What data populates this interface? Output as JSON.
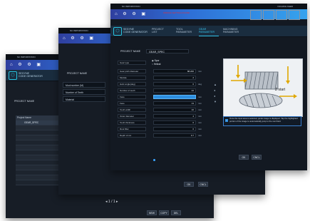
{
  "app": {
    "name": "NC IMPORTATION",
    "brand_line1": "SEGYNE",
    "brand_line2": "CODE GENERATOR"
  },
  "tabs": {
    "project_list": "PROJECT LIST",
    "tool_parameter": "TOOL PARAMETER",
    "gear_parameter": "GEAR PARAMETER",
    "machining_parameter": "MACHINING PARAMETER"
  },
  "window1": {
    "section": "PROJECT NAME",
    "table_header": "Project Name",
    "first_row": "GEAR_SPEC",
    "pager": "1 / 1",
    "buttons": [
      "NEW",
      "COPY",
      "DEL"
    ]
  },
  "window2": {
    "section": "PROJECT NAME",
    "items": [
      "Mod number (M)",
      "Number of Teeth",
      "Material"
    ]
  },
  "window3": {
    "header_warning": "WRONG SETTING FOUND",
    "status": "INCHING FEED",
    "section": "PROJECT NAME",
    "project_value": "GEAR_SPEC",
    "gear_type": "Gear type",
    "radio_options": [
      "Spur",
      "Helical"
    ],
    "params": [
      {
        "label": "Gear pitch diameter",
        "value": "88.200",
        "unit": "mm"
      },
      {
        "label": "Module",
        "value": "2",
        "unit": ""
      },
      {
        "label": "Helix angle(deg)",
        "value": "0",
        "unit": "deg"
      },
      {
        "label": "Number of teeth",
        "value": "42",
        "unit": ""
      },
      {
        "label": "Face",
        "value": "",
        "unit": "mm"
      },
      {
        "label": "Face",
        "value": "13",
        "unit": "mm"
      },
      {
        "label": "Tooth width",
        "value": "10",
        "unit": "mm"
      },
      {
        "label": "Outer diameter",
        "value": "4",
        "unit": "mm"
      },
      {
        "label": "Tooth thickness",
        "value": "0",
        "unit": "mm"
      },
      {
        "label": "Root fillet",
        "value": "0",
        "unit": "mm"
      },
      {
        "label": "Depth of cut",
        "value": "0.7",
        "unit": "mm"
      }
    ],
    "diagram_label": "Z start",
    "note": "Once the input area is selected, guide image is displayed. Tap the highlighted portion of the image to automatically jump to the next field.",
    "buttons": [
      "OK",
      "CNCL"
    ]
  }
}
